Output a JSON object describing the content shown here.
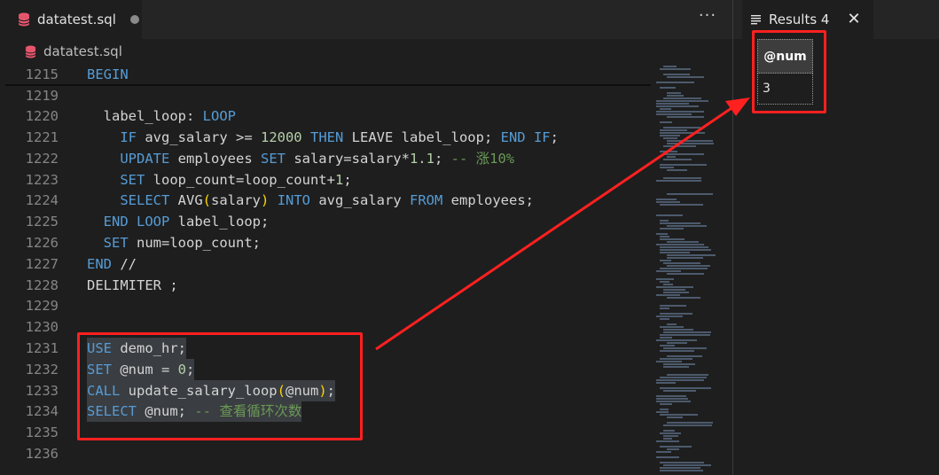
{
  "editor": {
    "tab": {
      "label": "datatest.sql",
      "icon": "database-icon",
      "unsaved": true
    },
    "more_actions": "···",
    "breadcrumb": {
      "label": "datatest.sql",
      "icon": "database-icon"
    },
    "lines": [
      {
        "num": "1215",
        "text": "BEGIN"
      },
      {
        "num": "1219",
        "text": ""
      },
      {
        "num": "1220",
        "text": "  label_loop: LOOP"
      },
      {
        "num": "1221",
        "text": "    IF avg_salary >= 12000 THEN LEAVE label_loop; END IF;"
      },
      {
        "num": "1222",
        "text": "    UPDATE employees SET salary=salary*1.1; -- 涨10%"
      },
      {
        "num": "1223",
        "text": "    SET loop_count=loop_count+1;"
      },
      {
        "num": "1224",
        "text": "    SELECT AVG(salary) INTO avg_salary FROM employees;"
      },
      {
        "num": "1225",
        "text": "  END LOOP label_loop;"
      },
      {
        "num": "1226",
        "text": "  SET num=loop_count;"
      },
      {
        "num": "1227",
        "text": "END //"
      },
      {
        "num": "1228",
        "text": "DELIMITER ;"
      },
      {
        "num": "1229",
        "text": ""
      },
      {
        "num": "1230",
        "text": ""
      },
      {
        "num": "1231",
        "text": "USE demo_hr;"
      },
      {
        "num": "1232",
        "text": "SET @num = 0;"
      },
      {
        "num": "1233",
        "text": "CALL update_salary_loop(@num);"
      },
      {
        "num": "1234",
        "text": "SELECT @num; -- 查看循环次数"
      },
      {
        "num": "1235",
        "text": ""
      },
      {
        "num": "1236",
        "text": ""
      }
    ]
  },
  "results": {
    "tab_label": "Results 4",
    "tab_icon": "list-lines-icon",
    "close_icon": "close-icon",
    "columns": [
      "@num"
    ],
    "rows": [
      [
        "3"
      ]
    ]
  },
  "colors": {
    "annotation": "#ff2020",
    "keyword": "#569cd6",
    "comment": "#6a9955",
    "number": "#b5cea8",
    "db_icon": "#e8566e"
  }
}
